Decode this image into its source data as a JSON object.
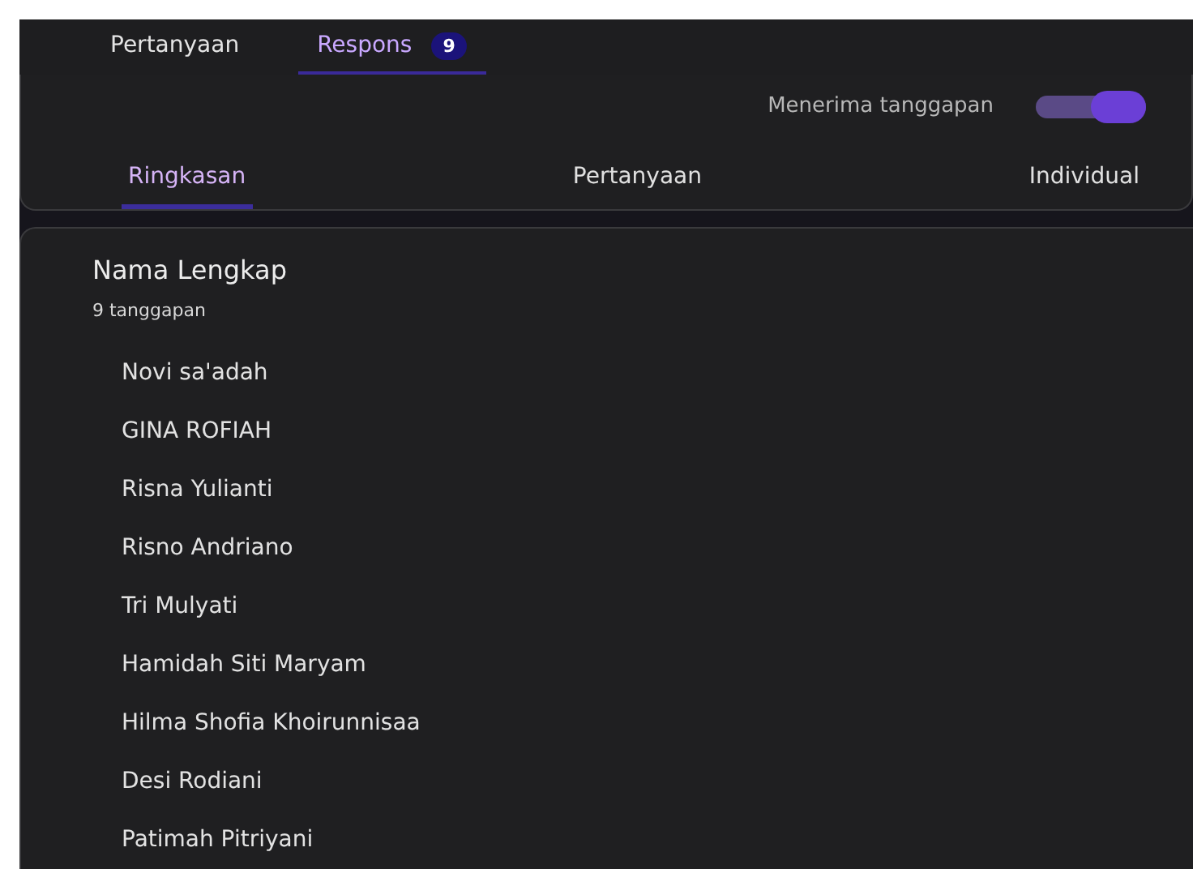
{
  "top_tabs": [
    {
      "label": "Pertanyaan",
      "selected": false
    },
    {
      "label": "Respons",
      "selected": true,
      "badge": "9"
    }
  ],
  "accepting": {
    "label": "Menerima tanggapan",
    "on": true
  },
  "sub_tabs": [
    {
      "label": "Ringkasan",
      "selected": true
    },
    {
      "label": "Pertanyaan",
      "selected": false
    },
    {
      "label": "Individual",
      "selected": false
    }
  ],
  "question": {
    "title": "Nama Lengkap",
    "count": "9 tanggapan",
    "answers": [
      "Novi sa'adah",
      "GINA ROFIAH",
      "Risna Yulianti",
      "Risno Andriano",
      "Tri Mulyati",
      "Hamidah Siti Maryam",
      "Hilma Shofia Khoirunnisaa",
      "Desi Rodiani",
      "Patimah Pitriyani"
    ]
  }
}
